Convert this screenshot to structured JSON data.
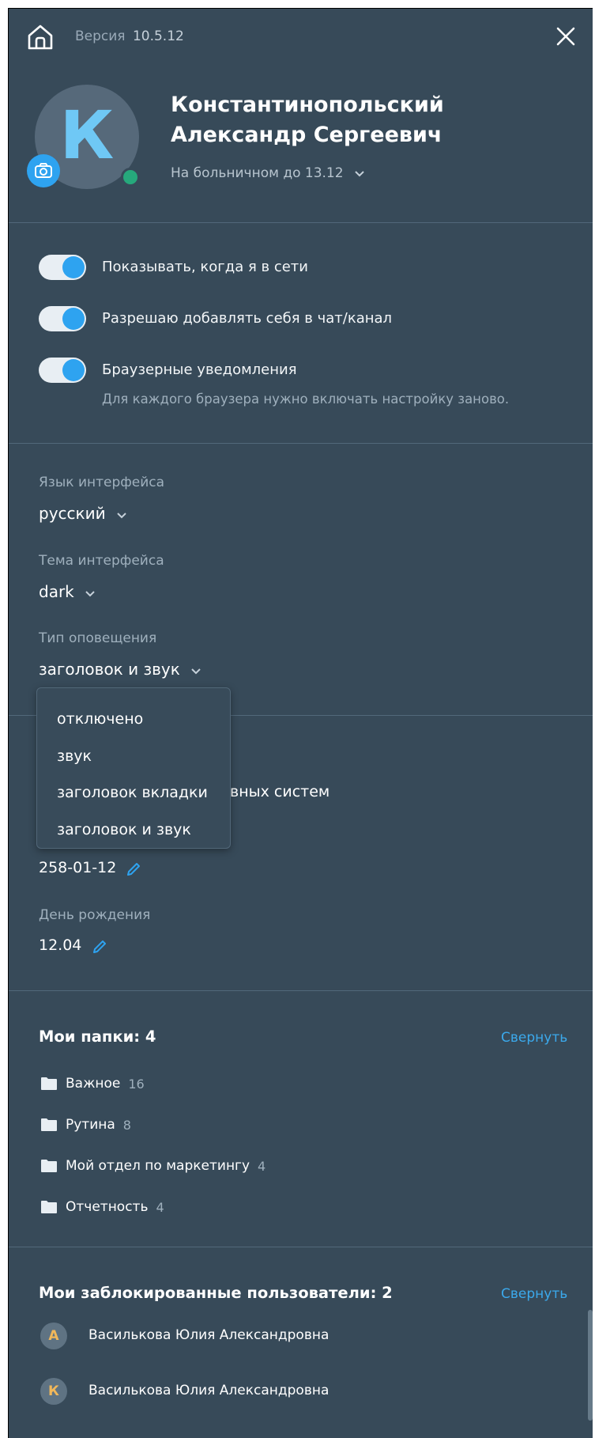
{
  "header": {
    "version_label": "Версия",
    "version_number": "10.5.12"
  },
  "profile": {
    "avatar_letter": "К",
    "name_line1": "Константинопольский",
    "name_line2": "Александр Сергеевич",
    "status": "На больничном до 13.12"
  },
  "toggles": [
    {
      "label": "Показывать, когда я в сети",
      "on": true
    },
    {
      "label": "Разрешаю добавлять себя в чат/канал",
      "on": true
    },
    {
      "label": "Браузерные уведомления",
      "on": true,
      "hint": "Для каждого браузера нужно включать настройку заново."
    }
  ],
  "settings": {
    "language": {
      "caption": "Язык интерфейса",
      "value": "русский"
    },
    "theme": {
      "caption": "Тема интерфейса",
      "value": "dark"
    },
    "notification": {
      "caption": "Тип оповещения",
      "value": "заголовок и звук"
    }
  },
  "dropdown": {
    "options": [
      "отключено",
      "звук",
      "заголовок вкладки",
      "заголовок и звук"
    ]
  },
  "hidden_section": {
    "partial_text": "вных систем",
    "phone": "258-01-12",
    "birthday_caption": "День рождения",
    "birthday": "12.04"
  },
  "folders": {
    "title": "Мои папки: 4",
    "collapse": "Свернуть",
    "items": [
      {
        "name": "Важное",
        "count": "16"
      },
      {
        "name": "Рутина",
        "count": "8"
      },
      {
        "name": "Мой отдел по маркетингу",
        "count": "4"
      },
      {
        "name": "Отчетность",
        "count": "4"
      }
    ]
  },
  "blocked": {
    "title": "Мои заблокированные пользователи: 2",
    "collapse": "Свернуть",
    "users": [
      {
        "letter": "А",
        "name": "Василькова Юлия Александровна"
      },
      {
        "letter": "К",
        "name": "Василькова Юлия Александровна"
      }
    ]
  },
  "colors": {
    "panel_bg": "#374a59",
    "accent": "#2ea3f0",
    "online": "#26a97c",
    "link": "#3ba9ec"
  }
}
